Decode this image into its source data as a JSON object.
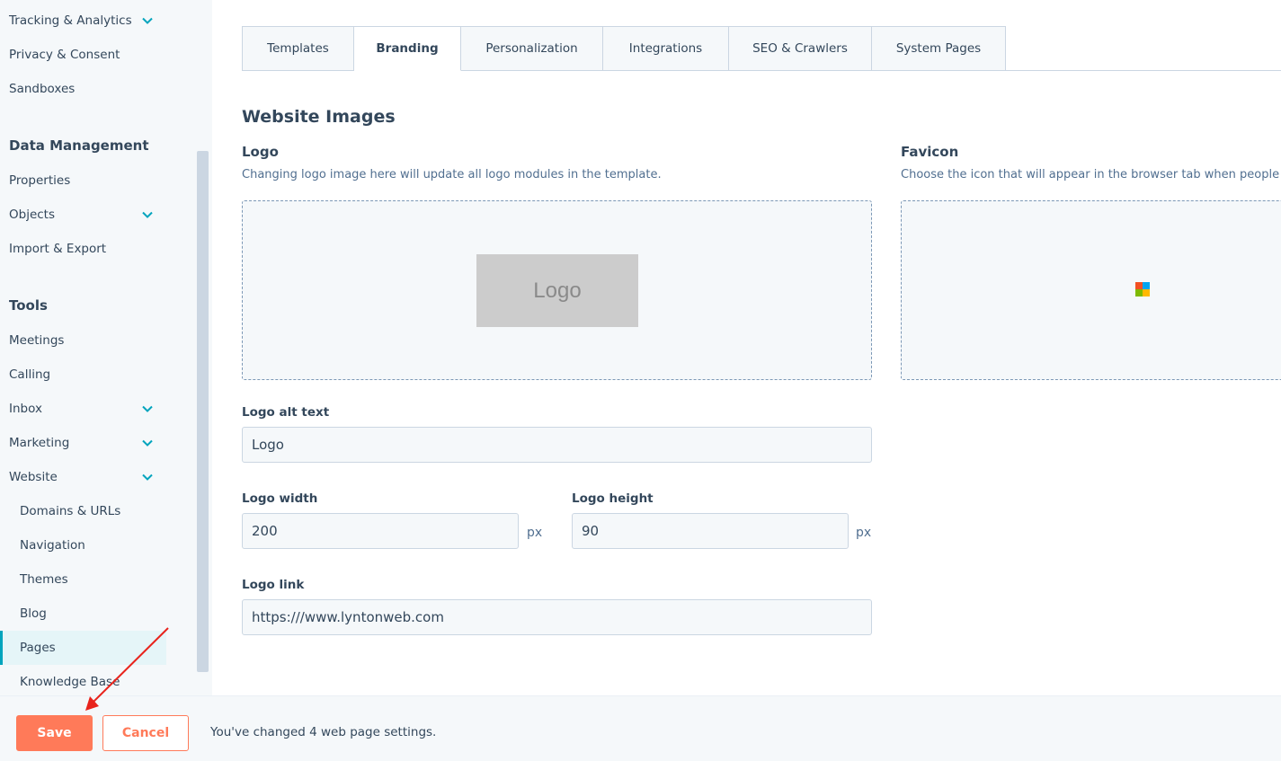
{
  "sidebar": {
    "items_top": [
      {
        "label": "Tracking & Analytics",
        "chevron": true
      },
      {
        "label": "Privacy & Consent",
        "chevron": false
      },
      {
        "label": "Sandboxes",
        "chevron": false
      }
    ],
    "data_management_heading": "Data Management",
    "data_management_items": [
      {
        "label": "Properties",
        "chevron": false
      },
      {
        "label": "Objects",
        "chevron": true
      },
      {
        "label": "Import & Export",
        "chevron": false
      }
    ],
    "tools_heading": "Tools",
    "tools_items": [
      {
        "label": "Meetings",
        "chevron": false
      },
      {
        "label": "Calling",
        "chevron": false
      },
      {
        "label": "Inbox",
        "chevron": true
      },
      {
        "label": "Marketing",
        "chevron": true
      },
      {
        "label": "Website",
        "chevron": true
      }
    ],
    "website_subitems": [
      {
        "label": "Domains & URLs"
      },
      {
        "label": "Navigation"
      },
      {
        "label": "Themes"
      },
      {
        "label": "Blog"
      },
      {
        "label": "Pages",
        "active": true
      },
      {
        "label": "Knowledge Base"
      }
    ]
  },
  "tabs": [
    {
      "label": "Templates"
    },
    {
      "label": "Branding",
      "active": true
    },
    {
      "label": "Personalization"
    },
    {
      "label": "Integrations"
    },
    {
      "label": "SEO & Crawlers"
    },
    {
      "label": "System Pages"
    }
  ],
  "main": {
    "section_title": "Website Images",
    "logo": {
      "title": "Logo",
      "help": "Changing logo image here will update all logo modules in the template.",
      "placeholder_text": "Logo"
    },
    "favicon": {
      "title": "Favicon",
      "help": "Choose the icon that will appear in the browser tab when people"
    },
    "fields": {
      "alt_label": "Logo alt text",
      "alt_value": "Logo",
      "width_label": "Logo width",
      "width_value": "200",
      "width_unit": "px",
      "height_label": "Logo height",
      "height_value": "90",
      "height_unit": "px",
      "link_label": "Logo link",
      "link_value": "https:///www.lyntonweb.com"
    }
  },
  "footer": {
    "save_label": "Save",
    "cancel_label": "Cancel",
    "message": "You've changed 4 web page settings."
  },
  "colors": {
    "accent": "#ff7a59",
    "active_nav": "#00a4bd",
    "text": "#33475b",
    "annotation_arrow": "#e8231c"
  }
}
